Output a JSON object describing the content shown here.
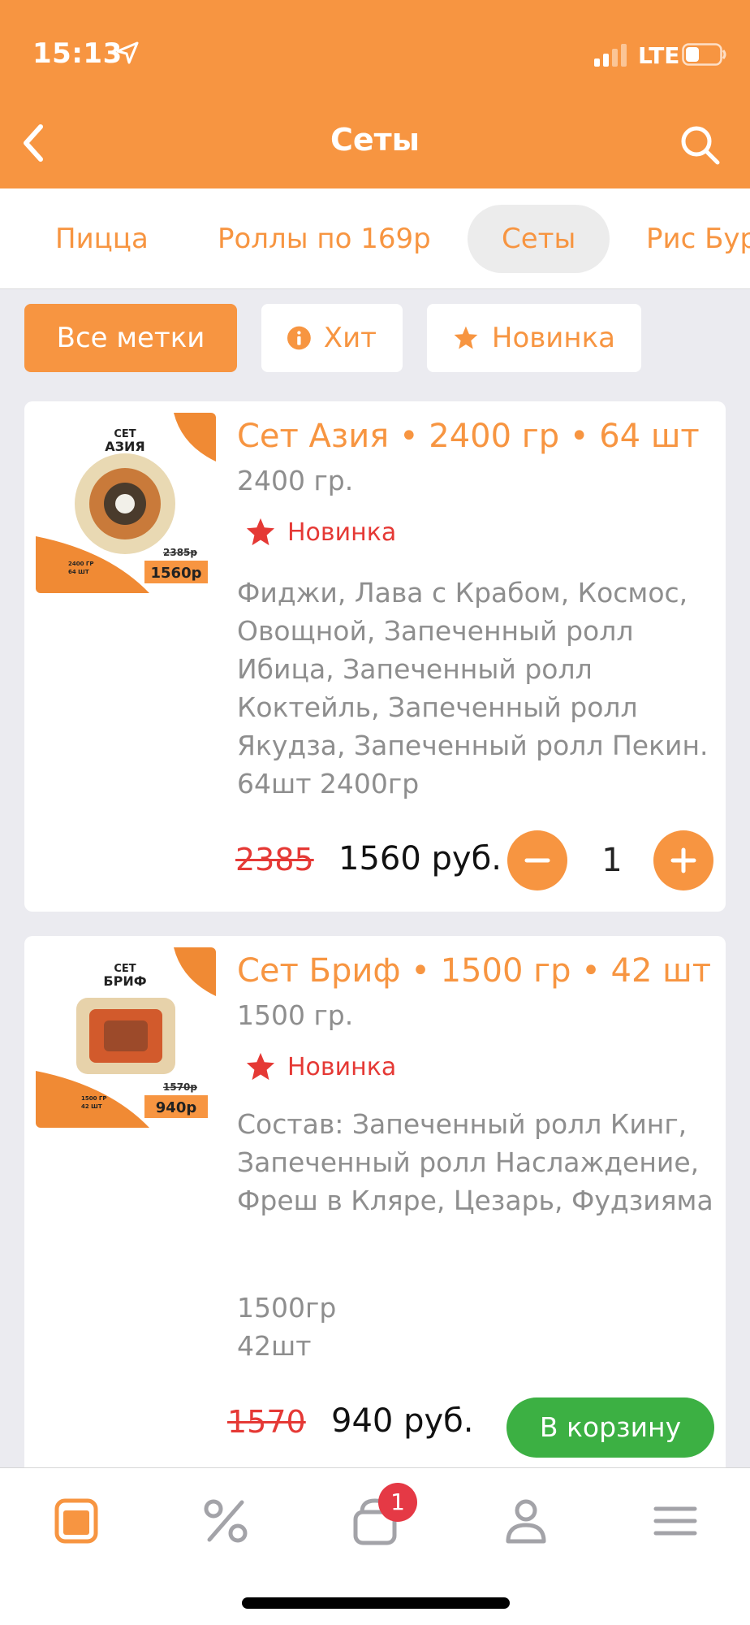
{
  "status_bar": {
    "time": "15:13",
    "network": "LTE"
  },
  "header": {
    "title": "Сеты"
  },
  "tabs": [
    {
      "label": "Пицца"
    },
    {
      "label": "Роллы по 169р"
    },
    {
      "label": "Сеты"
    },
    {
      "label": "Рис Бургер"
    }
  ],
  "filters": [
    {
      "label": "Все метки",
      "active": true
    },
    {
      "label": "Хит",
      "icon": "info-icon"
    },
    {
      "label": "Новинка",
      "icon": "star-icon"
    }
  ],
  "products": [
    {
      "title": "Сет Азия • 2400 гр • 64 шт",
      "weight": "2400 гр.",
      "badge": "Новинка",
      "description": "Фиджи, Лава с Крабом, Космос, Овощной, Запеченный ролл Ибица, Запеченный ролл Коктейль, Запеченный ролл Якудза, Запеченный ролл Пекин. 64шт 2400гр",
      "old_price": "2385",
      "price": "1560 руб.",
      "quantity": "1",
      "image": {
        "set_word": "СЕТ",
        "name": "АЗИЯ",
        "old": "2385р",
        "new": "1560р",
        "spec1": "2400 ГР",
        "spec2": "64 ШТ"
      }
    },
    {
      "title": "Сет Бриф • 1500 гр • 42 шт",
      "weight": "1500 гр.",
      "badge": "Новинка",
      "description": "Состав: Запеченный ролл Кинг, Запеченный ролл Наслаждение, Фреш в Кляре, Цезарь, Фудзияма",
      "extra_line1": "1500гр",
      "extra_line2": "42шт",
      "old_price": "1570",
      "price": "940 руб.",
      "cart_label": "В корзину",
      "image": {
        "set_word": "СЕТ",
        "name": "БРИФ",
        "old": "1570р",
        "new": "940р",
        "spec1": "1500 ГР",
        "spec2": "42 ШТ"
      }
    }
  ],
  "bottom_nav": {
    "cart_count": "1"
  },
  "colors": {
    "accent": "#f79541",
    "price_old": "#e53935",
    "cart_button": "#3cb043",
    "badge": "#e53945"
  }
}
